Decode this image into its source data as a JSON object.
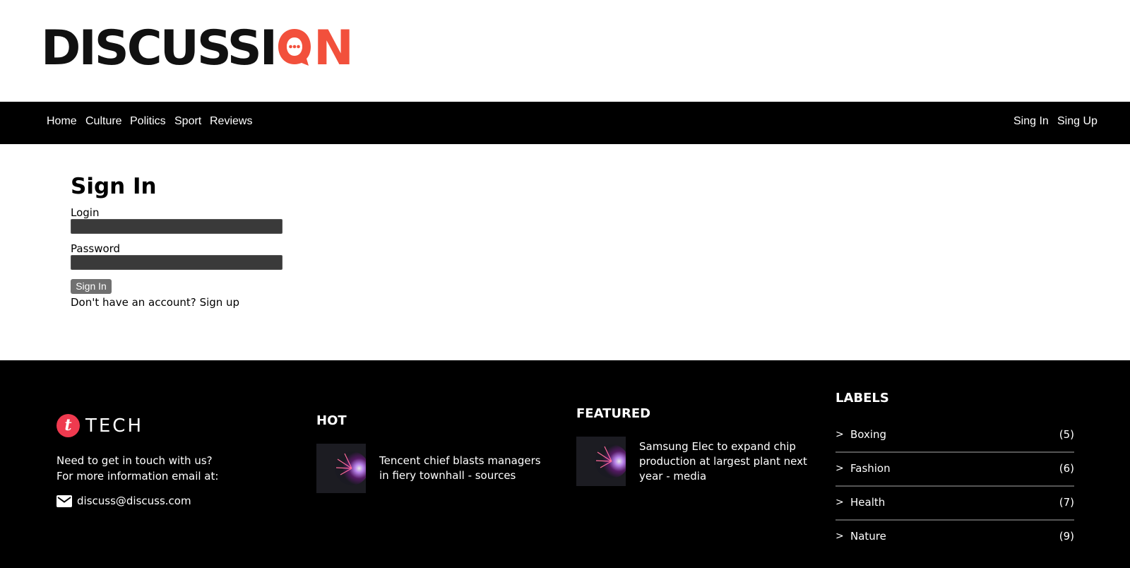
{
  "header": {
    "logo": {
      "text_prefix": "DISCUSSI",
      "text_suffix": "N",
      "full_text": "DISCUSSION"
    }
  },
  "nav": {
    "left": [
      "Home",
      "Culture",
      "Politics",
      "Sport",
      "Reviews"
    ],
    "right": [
      "Sing In",
      "Sing Up"
    ]
  },
  "signin": {
    "title": "Sign In",
    "login_label": "Login",
    "login_value": "",
    "password_label": "Password",
    "password_value": "",
    "submit_label": "Sign In",
    "no_account_text": "Don't have an account?",
    "signup_link": "Sign up"
  },
  "footer": {
    "brand": {
      "mark": "t",
      "word": "TECH"
    },
    "contact": {
      "line1": "Need to get in touch with us?",
      "line2": "For more information email at:",
      "email": "discuss@discuss.com"
    },
    "hot": {
      "title": "HOT",
      "post_title": "Tencent chief blasts managers in fiery townhall - sources"
    },
    "featured": {
      "title": "FEATURED",
      "post_title": "Samsung Elec to expand chip production at largest plant next year - media"
    },
    "labels": {
      "title": "LABELS",
      "items": [
        {
          "name": "Boxing",
          "count": "(5)"
        },
        {
          "name": "Fashion",
          "count": "(6)"
        },
        {
          "name": "Health",
          "count": "(7)"
        },
        {
          "name": "Nature",
          "count": "(9)"
        }
      ]
    }
  },
  "colors": {
    "accent": "#f2503c",
    "nav_bg": "#000000",
    "brand_red": "#ef3a4f",
    "input_bg": "#3a3a3a",
    "button_bg": "#707070"
  }
}
